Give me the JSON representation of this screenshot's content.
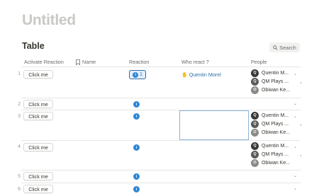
{
  "page": {
    "title": "Untitled"
  },
  "table": {
    "title": "Table",
    "search_label": "Search",
    "columns": [
      "Activate Reaction",
      "Name",
      "Reaction",
      "Who react ?",
      "People"
    ],
    "rows": [
      {
        "num": "1",
        "button": "Click me",
        "reaction_count": "1",
        "who": "Quentin Morel",
        "people": [
          "Quentin M...",
          "QM Plays ...",
          "Obiwan Ke..."
        ]
      },
      {
        "num": "2",
        "button": "Click me",
        "people": []
      },
      {
        "num": "3",
        "button": "Click me",
        "people": [
          "Quentin M...",
          "QM Plays ...",
          "Obiwan Ke..."
        ]
      },
      {
        "num": "4",
        "button": "Click me",
        "people": [
          "Quentin M...",
          "QM Plays ...",
          "Obiwan Ke..."
        ]
      },
      {
        "num": "5",
        "button": "Click me",
        "people": []
      },
      {
        "num": "6",
        "button": "Click me",
        "people": []
      }
    ],
    "trailing_comma": ","
  },
  "colors": {
    "accent": "#2f86d6",
    "link": "#2f6fa8",
    "title_gray": "#c9c9c6"
  },
  "icons": {
    "search": "search-icon",
    "name_col": "bookmark-icon",
    "hand": "hand-icon",
    "chevron": "chevron-down-icon"
  }
}
